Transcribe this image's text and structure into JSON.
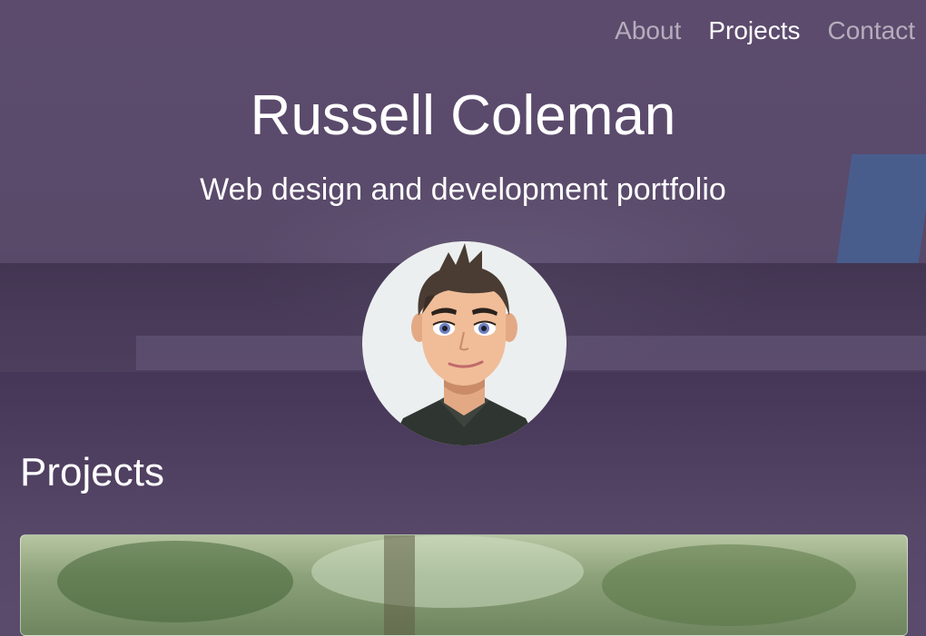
{
  "nav": {
    "items": [
      {
        "label": "About",
        "active": false
      },
      {
        "label": "Projects",
        "active": true
      },
      {
        "label": "Contact",
        "active": false
      }
    ]
  },
  "header": {
    "title": "Russell Coleman",
    "subtitle": "Web design and development portfolio"
  },
  "avatar": {
    "icon": "cartoon-avatar-image"
  },
  "projects": {
    "title": "Projects"
  },
  "colors": {
    "overlay": "#5a4a6c",
    "text": "#ffffff",
    "nav_inactive": "rgba(255,255,255,0.55)"
  }
}
